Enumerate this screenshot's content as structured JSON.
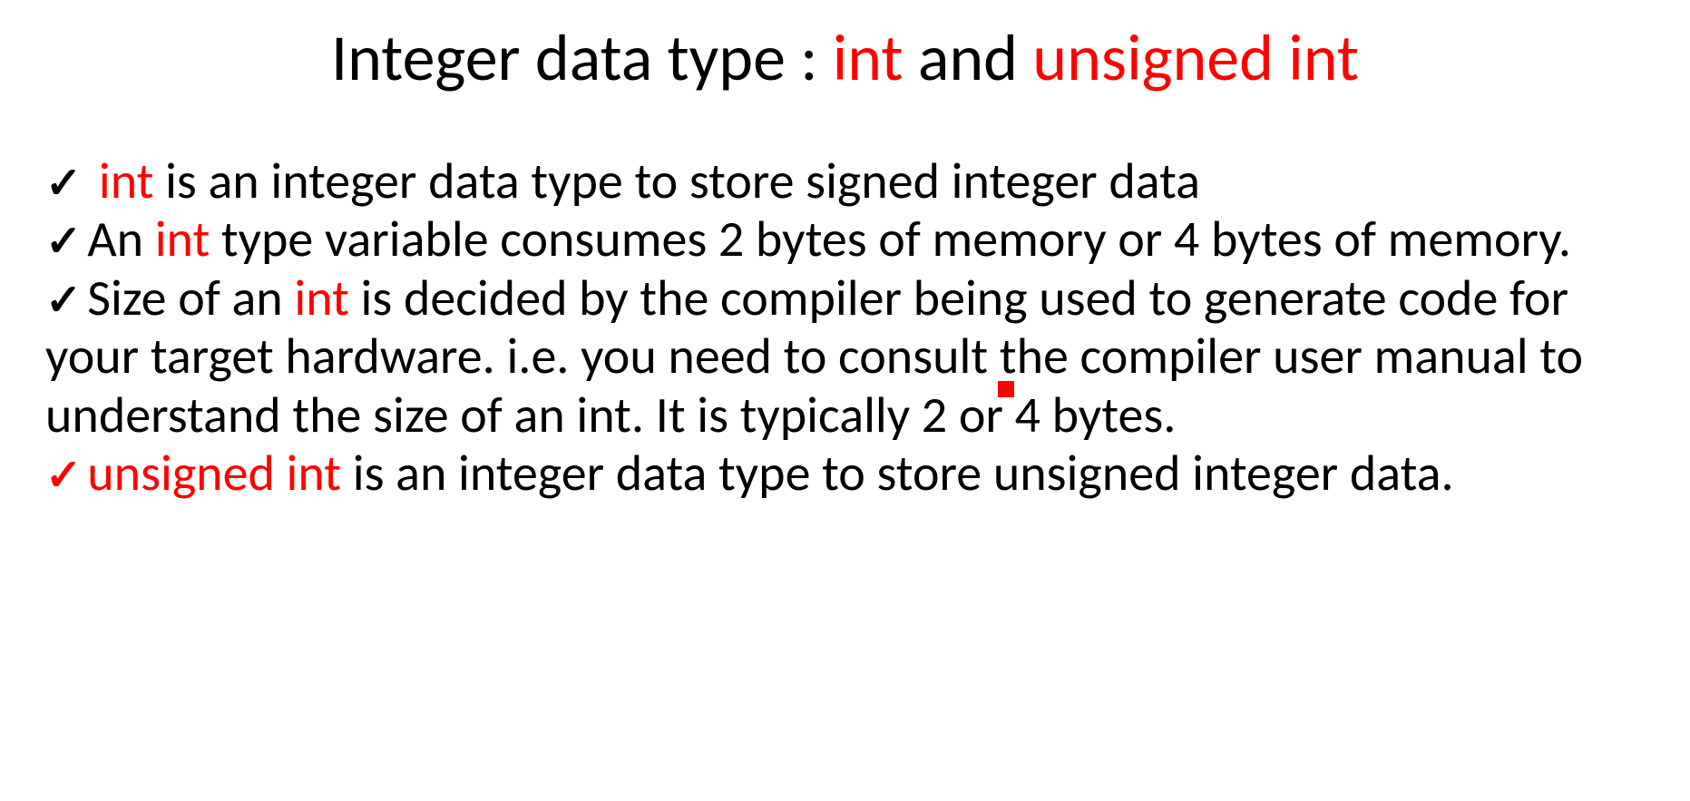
{
  "title": {
    "pre": "Integer data type : ",
    "kw1": "int",
    "mid": " and ",
    "kw2": "unsigned int"
  },
  "bullets": {
    "b1": {
      "kw": "int",
      "rest": " is an integer data type to store signed integer data"
    },
    "b2": {
      "pre": "An ",
      "kw": "int",
      "rest": " type variable consumes 2 bytes of memory or 4 bytes of memory."
    },
    "b3": {
      "pre": "Size of an ",
      "kw": "int",
      "rest": " is decided by the compiler being used to generate code for your target hardware. i.e. you need to consult the compiler user manual to understand the size of an int. It is typically 2 or 4 bytes."
    },
    "b4": {
      "kw": "unsigned int",
      "rest": " is an integer data type to store unsigned integer data."
    }
  },
  "checkmark": "✓"
}
